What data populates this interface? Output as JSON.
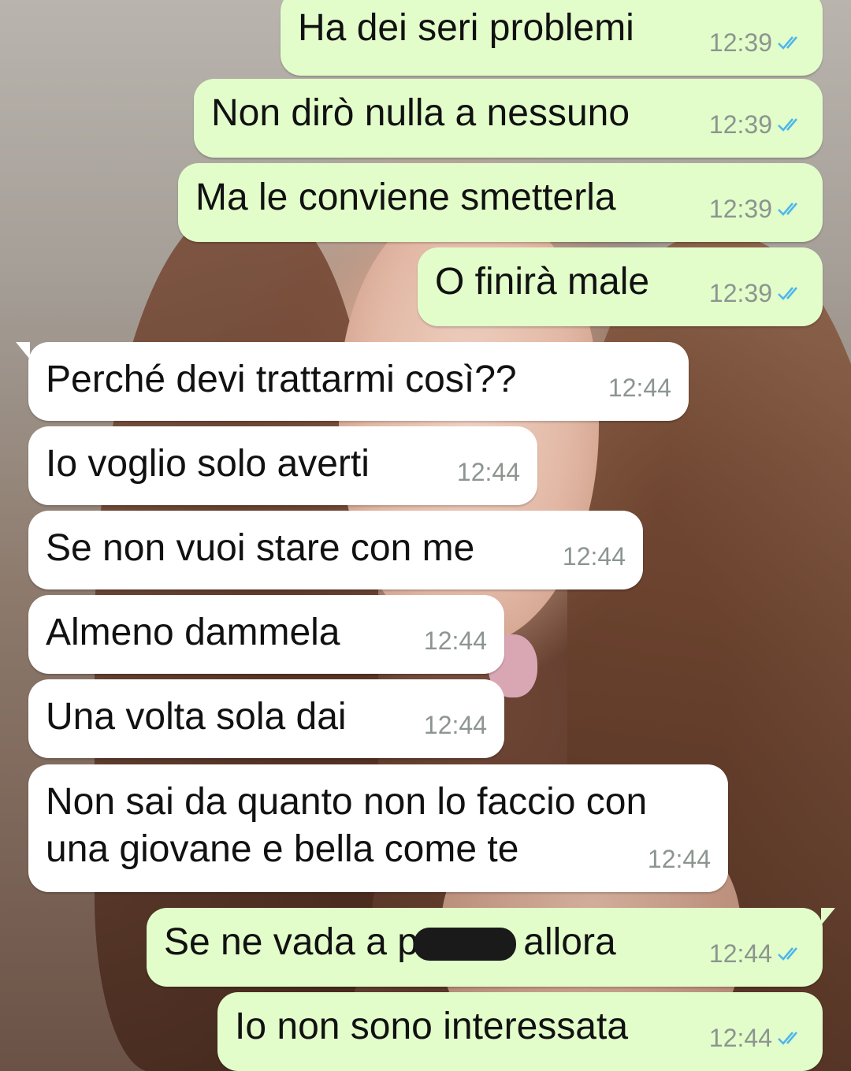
{
  "messages": [
    {
      "direction": "out",
      "text": "Ha dei seri problemi",
      "time": "12:39",
      "status": "read"
    },
    {
      "direction": "out",
      "text": "Non dirò nulla a nessuno",
      "time": "12:39",
      "status": "read"
    },
    {
      "direction": "out",
      "text": "Ma le conviene smetterla",
      "time": "12:39",
      "status": "read"
    },
    {
      "direction": "out",
      "text": "O finirà male",
      "time": "12:39",
      "status": "read"
    },
    {
      "direction": "in",
      "text": "Perché devi trattarmi così??",
      "time": "12:44"
    },
    {
      "direction": "in",
      "text": "Io voglio solo averti",
      "time": "12:44"
    },
    {
      "direction": "in",
      "text": "Se non vuoi stare con me",
      "time": "12:44"
    },
    {
      "direction": "in",
      "text": "Almeno dammela",
      "time": "12:44"
    },
    {
      "direction": "in",
      "text": "Una volta sola dai",
      "time": "12:44"
    },
    {
      "direction": "in",
      "text": "Non sai da quanto non lo faccio con una giovane e bella come te",
      "time": "12:44"
    },
    {
      "direction": "out",
      "text_before": "Se ne vada a p",
      "text_after": "allora",
      "time": "12:44",
      "status": "read",
      "redacted": true
    },
    {
      "direction": "out",
      "text": "Io non sono interessata",
      "time": "12:44",
      "status": "read"
    }
  ],
  "colors": {
    "outgoing_bubble": "#e2fdca",
    "incoming_bubble": "#ffffff",
    "read_ticks": "#4fb6ec",
    "timestamp": "#8c9590"
  },
  "icons": {
    "read_receipt": "double-check-icon"
  }
}
